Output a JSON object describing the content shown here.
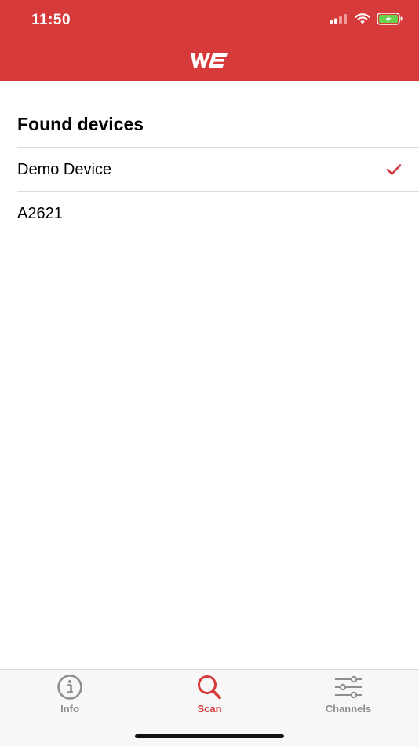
{
  "status_bar": {
    "time": "11:50"
  },
  "colors": {
    "brand": "#d63a3a",
    "tab_inactive": "#8e8e8e",
    "divider": "#dcdcdc"
  },
  "logo": {
    "text": "WE"
  },
  "main": {
    "title": "Found devices",
    "devices": [
      {
        "name": "Demo Device",
        "selected": true
      },
      {
        "name": "A2621",
        "selected": false
      }
    ]
  },
  "tabbar": {
    "tabs": [
      {
        "label": "Info",
        "icon": "info-icon",
        "active": false
      },
      {
        "label": "Scan",
        "icon": "search-icon",
        "active": true
      },
      {
        "label": "Channels",
        "icon": "sliders-icon",
        "active": false
      }
    ]
  }
}
